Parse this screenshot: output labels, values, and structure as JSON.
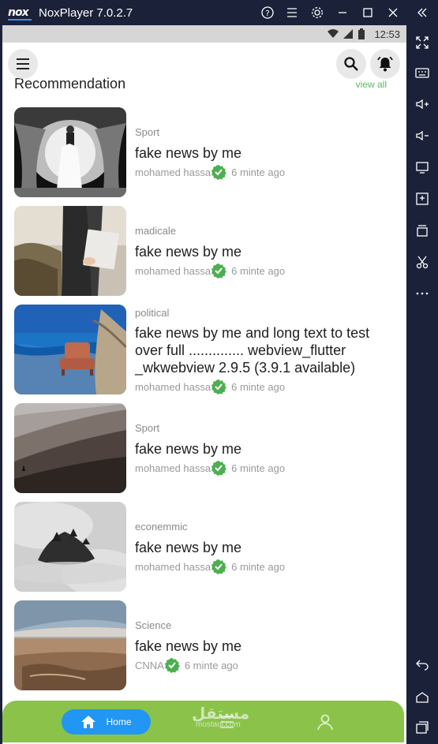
{
  "window": {
    "logo": "nox",
    "title": "NoxPlayer 7.0.2.7",
    "controls": [
      "help-icon",
      "menu-icon",
      "settings-icon",
      "minimize-icon",
      "maximize-icon",
      "close-icon",
      "collapse-icon"
    ]
  },
  "statusbar": {
    "time": "12:53"
  },
  "section": {
    "title": "Recommendation",
    "view_all": "view all"
  },
  "news": [
    {
      "category": "Sport",
      "headline": "fake news by me",
      "author": "mohamed hassa",
      "time": "6 minte ago",
      "thumb": "wedding"
    },
    {
      "category": "madicale",
      "headline": "fake news by me",
      "author": "mohamed hassa",
      "time": "6 minte ago",
      "thumb": "businessman"
    },
    {
      "category": "political",
      "headline": "fake news by me and long text to test over full .............. webview_flutter _wkwebview  2.9.5 (3.9.1 available)",
      "author": "mohamed hassa",
      "time": "6 minte ago",
      "thumb": "seaside-chair"
    },
    {
      "category": "Sport",
      "headline": "fake news by me",
      "author": "mohamed hassa",
      "time": "6 minte ago",
      "thumb": "misty-hill"
    },
    {
      "category": "econemmic",
      "headline": "fake news by me",
      "author": "mohamed hassa",
      "time": "6 minte ago",
      "thumb": "foggy-island"
    },
    {
      "category": "Science",
      "headline": "fake news by me",
      "author": "CNNA",
      "time": "6 minte ago",
      "thumb": "canyon"
    }
  ],
  "bottom_nav": {
    "home_label": "Home",
    "watermark": "مستقل",
    "watermark_sub": "mostaql.com"
  },
  "colors": {
    "accent_green": "#8bc34a",
    "verified_green": "#4caf50",
    "home_blue": "#2196f3",
    "frame": "#1b2138"
  }
}
